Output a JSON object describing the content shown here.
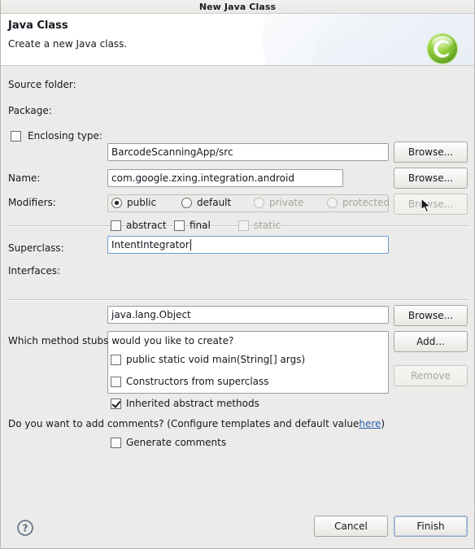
{
  "window": {
    "title": "New Java Class"
  },
  "header": {
    "title": "Java Class",
    "subtitle": "Create a new Java class.",
    "icon": "java-class-wizard-icon"
  },
  "form": {
    "source_folder": {
      "label": "Source folder:",
      "value": "BarcodeScanningApp/src",
      "placeholder": "",
      "browse_label": "Browse..."
    },
    "package": {
      "label": "Package:",
      "value": "com.google.zxing.integration.android",
      "placeholder": "",
      "browse_label": "Browse..."
    },
    "enclosing_type": {
      "label": "Enclosing type:",
      "value": "",
      "placeholder": "",
      "checked": false,
      "enabled": false,
      "browse_label": "Browse..."
    },
    "name": {
      "label": "Name:",
      "value": "IntentIntegrator",
      "placeholder": "",
      "focused": true
    },
    "modifiers": {
      "label": "Modifiers:",
      "radios": [
        {
          "label": "public",
          "checked": true,
          "enabled": true
        },
        {
          "label": "default",
          "checked": false,
          "enabled": true
        },
        {
          "label": "private",
          "checked": false,
          "enabled": false
        },
        {
          "label": "protected",
          "checked": false,
          "enabled": false
        }
      ],
      "checkboxes": [
        {
          "label": "abstract",
          "checked": false,
          "enabled": true
        },
        {
          "label": "final",
          "checked": false,
          "enabled": true
        },
        {
          "label": "static",
          "checked": false,
          "enabled": false
        }
      ]
    },
    "superclass": {
      "label": "Superclass:",
      "value": "java.lang.Object",
      "placeholder": "",
      "browse_label": "Browse..."
    },
    "interfaces": {
      "label": "Interfaces:",
      "items": [],
      "add_label": "Add...",
      "remove_label": "Remove",
      "remove_enabled": false
    }
  },
  "stubs": {
    "question": "Which method stubs would you like to create?",
    "options": [
      {
        "label": "public static void main(String[] args)",
        "checked": false
      },
      {
        "label": "Constructors from superclass",
        "checked": false
      },
      {
        "label": "Inherited abstract methods",
        "checked": true
      }
    ]
  },
  "comments": {
    "question_prefix": "Do you want to add comments? (Configure templates and default value ",
    "link_label": "here",
    "question_suffix": ")",
    "option": {
      "label": "Generate comments",
      "checked": false
    }
  },
  "footer": {
    "help_label": "?",
    "cancel_label": "Cancel",
    "finish_label": "Finish"
  },
  "colors": {
    "dialog_bg": "#ecebe9",
    "header_bg": "#ffffff",
    "link": "#2a5db0",
    "accent_green": "#7cc241",
    "focus_blue": "#6f9fd0"
  }
}
